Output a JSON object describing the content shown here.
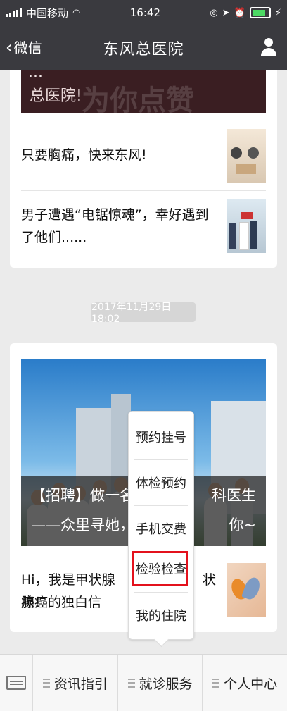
{
  "status_bar": {
    "carrier": "中国移动",
    "time": "16:42"
  },
  "nav": {
    "back_label": "微信",
    "title": "东风总医院"
  },
  "feed": {
    "top_banner": {
      "line1": "...",
      "line2": "总医院!"
    },
    "articles": [
      {
        "title": "只要胸痛，快来东风!"
      },
      {
        "title": "男子遭遇“电锯惊魂”，幸好遇到了他们......"
      }
    ],
    "timestamp": "2017年11月29日 18:02",
    "hero": {
      "line1": "【招聘】做一名",
      "line1_right": "科医生",
      "line2": "——众里寻她，",
      "line2_right": "你~"
    },
    "article2": {
      "line1": "Hi，我是甲状腺癌！",
      "line1_right": "状",
      "line2": "腺癌的独白信"
    }
  },
  "popup_menu": {
    "items": [
      "预约挂号",
      "体检预约",
      "手机交费",
      "检验检查",
      "我的住院"
    ],
    "highlighted": "检验检查",
    "highlight_color": "#e3111c"
  },
  "bottom_menu": {
    "tabs": [
      "资讯指引",
      "就诊服务",
      "个人中心"
    ]
  }
}
